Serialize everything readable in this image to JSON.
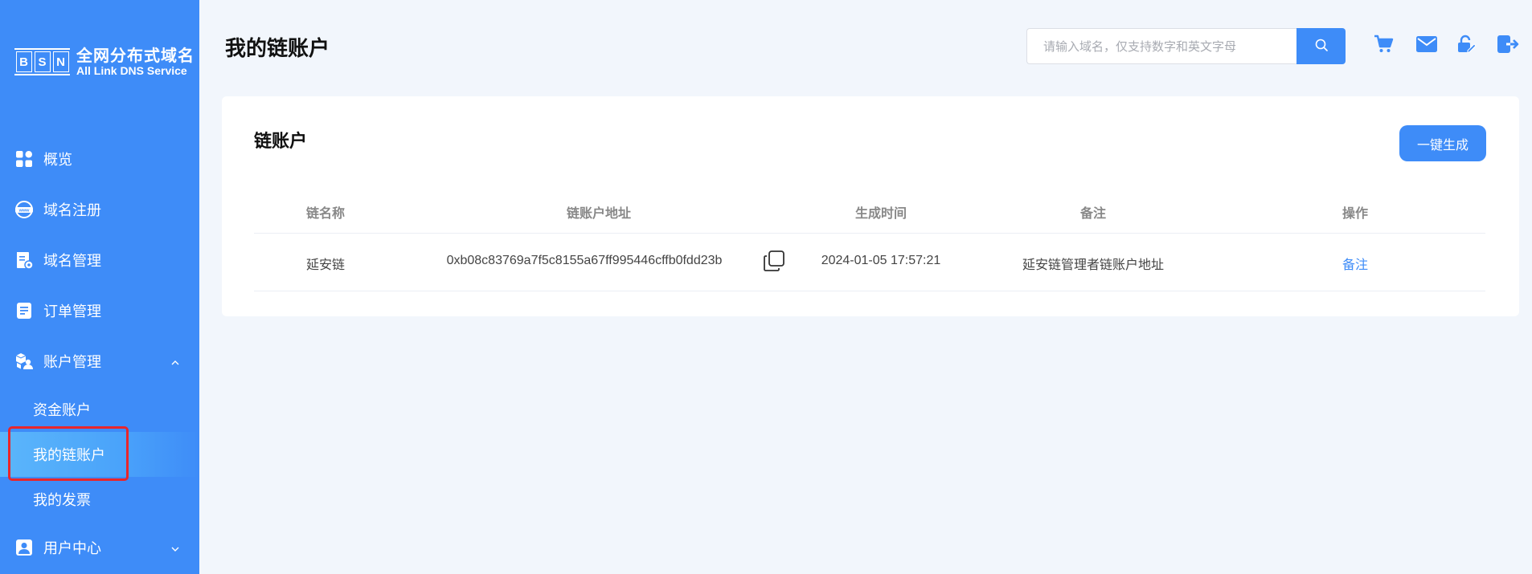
{
  "logo": {
    "letters": [
      "B",
      "S",
      "N"
    ],
    "title_cn": "全网分布式域名",
    "title_en": "All Link DNS Service"
  },
  "sidebar": {
    "items": [
      {
        "label": "概览",
        "icon": "grid-icon"
      },
      {
        "label": "域名注册",
        "icon": "www-globe-icon"
      },
      {
        "label": "域名管理",
        "icon": "document-settings-icon"
      },
      {
        "label": "订单管理",
        "icon": "order-list-icon"
      },
      {
        "label": "账户管理",
        "icon": "account-cubes-icon",
        "expanded": true
      },
      {
        "label": "用户中心",
        "icon": "user-profile-icon",
        "expanded": false
      }
    ],
    "sub_items": [
      {
        "label": "资金账户"
      },
      {
        "label": "我的链账户",
        "active": true
      },
      {
        "label": "我的发票"
      }
    ]
  },
  "header": {
    "title": "我的链账户",
    "search_placeholder": "请输入域名，仅支持数字和英文字母",
    "icons": [
      "cart-icon",
      "mail-icon",
      "lock-edit-icon",
      "logout-icon"
    ]
  },
  "card": {
    "title": "链账户",
    "generate_button": "一键生成",
    "columns": [
      "链名称",
      "链账户地址",
      "生成时间",
      "备注",
      "操作"
    ],
    "rows": [
      {
        "chain_name": "延安链",
        "address": "0xb08c83769a7f5c8155a67ff995446cffb0fdd23b",
        "created_at": "2024-01-05 17:57:21",
        "remark": "延安链管理者链账户地址",
        "action": "备注"
      }
    ]
  },
  "colors": {
    "primary": "#3e8cf8",
    "background": "#f2f6fc",
    "highlight": "#e8262b"
  }
}
